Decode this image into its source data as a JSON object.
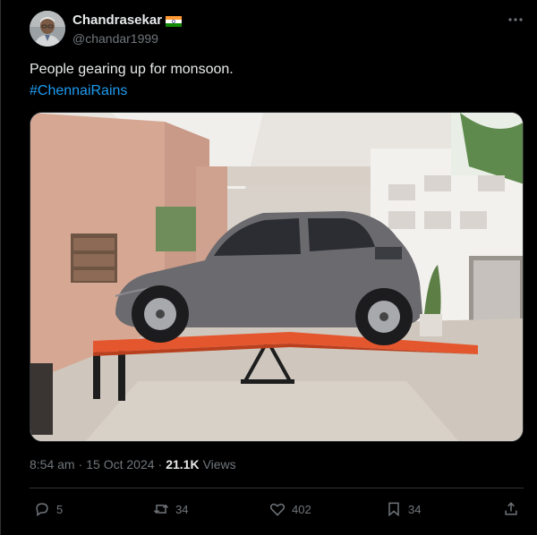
{
  "author": {
    "display_name": "Chandrasekar",
    "handle": "@chandar1999",
    "flag_icon": "india-flag-icon"
  },
  "tweet": {
    "text": "People gearing up for monsoon.",
    "hashtag": "#ChennaiRains"
  },
  "meta": {
    "time": "8:54 am",
    "separator1": "·",
    "date": "15 Oct 2024",
    "separator2": "·",
    "views_count": "21.1K",
    "views_label": "Views"
  },
  "actions": {
    "replies": "5",
    "reposts": "34",
    "likes": "402",
    "bookmarks": "34"
  },
  "colors": {
    "background": "#000000",
    "text": "#e7e9ea",
    "muted": "#71767b",
    "link": "#1d9bf0",
    "border": "#2f3336"
  }
}
